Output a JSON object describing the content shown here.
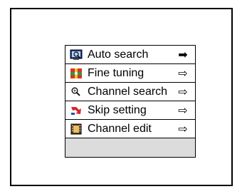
{
  "menu": {
    "items": [
      {
        "label": "Auto search",
        "icon": "magnifier-screen-icon",
        "arrow": "➡"
      },
      {
        "label": "Fine tuning",
        "icon": "tuning-cross-icon",
        "arrow": "⇨"
      },
      {
        "label": "Channel search",
        "icon": "search-icon",
        "arrow": "⇨"
      },
      {
        "label": "Skip setting",
        "icon": "skip-arrow-icon",
        "arrow": "⇨"
      },
      {
        "label": "Channel edit",
        "icon": "film-edit-icon",
        "arrow": "⇨"
      }
    ]
  },
  "colors": {
    "border": "#000000",
    "empty_row": "#dcdcdc"
  }
}
